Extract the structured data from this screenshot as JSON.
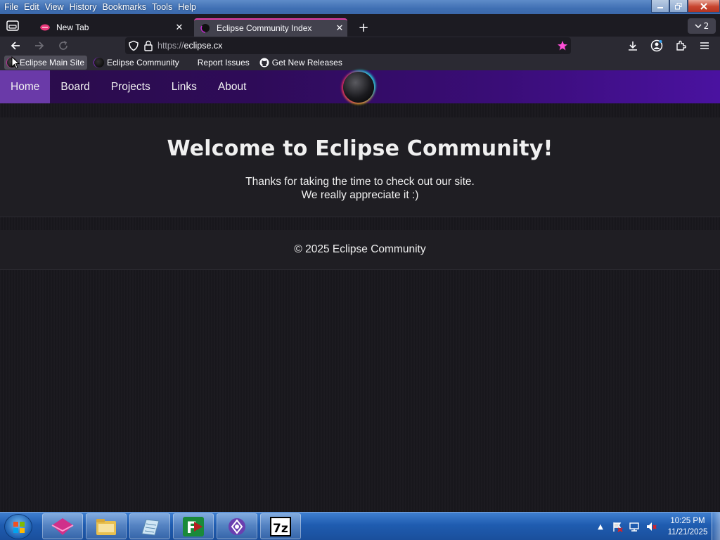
{
  "menubar": {
    "file": "File",
    "edit": "Edit",
    "view": "View",
    "history": "History",
    "bookmarks": "Bookmarks",
    "tools": "Tools",
    "help": "Help"
  },
  "tabs": [
    {
      "label": "New Tab",
      "active": false
    },
    {
      "label": "Eclipse Community Index",
      "active": true
    }
  ],
  "tab_count": "2",
  "urlbar": {
    "protocol": "https://",
    "host": "eclipse.cx"
  },
  "bookmarks": [
    {
      "label": "Eclipse Main Site"
    },
    {
      "label": "Eclipse Community"
    },
    {
      "label": "Report Issues"
    },
    {
      "label": "Get New Releases"
    }
  ],
  "site": {
    "nav": [
      "Home",
      "Board",
      "Projects",
      "Links",
      "About"
    ],
    "active_nav": "Home",
    "hero_title": "Welcome to Eclipse Community!",
    "hero_line1": "Thanks for taking the time to check out our site.",
    "hero_line2": "We really appreciate it :)",
    "footer": "© 2025 Eclipse Community"
  },
  "taskbar": {
    "clock_time": "10:25 PM",
    "clock_date": "11/21/2025",
    "apps": [
      "pink-cube-app",
      "file-explorer",
      "notepad-app",
      "filezilla-app",
      "eclipse-app",
      "7zip-app"
    ]
  },
  "colors": {
    "accent_tab": "#e03fa8",
    "nav_gradient_start": "#2a0d4a",
    "nav_gradient_end": "#4a12a0",
    "nav_active": "#6a3aa8",
    "bookmark_star": "#ff4fd8"
  }
}
